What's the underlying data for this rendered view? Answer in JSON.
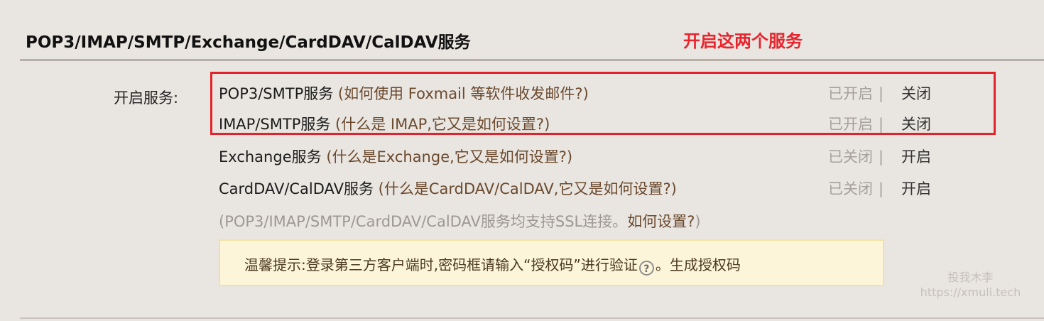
{
  "header": {
    "title": "POP3/IMAP/SMTP/Exchange/CardDAV/CalDAV服务"
  },
  "annotation": {
    "text": "开启这两个服务",
    "color": "#e8242d"
  },
  "enable_label": "开启服务:",
  "services": [
    {
      "name": "POP3/SMTP服务",
      "help": "(如何使用 Foxmail 等软件收发邮件?)",
      "status": "已开启",
      "separator": "|",
      "action": "关闭"
    },
    {
      "name": "IMAP/SMTP服务",
      "help": "(什么是 IMAP,它又是如何设置?)",
      "status": "已开启",
      "separator": "|",
      "action": "关闭"
    },
    {
      "name": "Exchange服务",
      "help": "(什么是Exchange,它又是如何设置?)",
      "status": "已关闭",
      "separator": "|",
      "action": "开启"
    },
    {
      "name": "CardDAV/CalDAV服务",
      "help": "(什么是CardDAV/CalDAV,它又是如何设置?)",
      "status": "已关闭",
      "separator": "|",
      "action": "开启"
    }
  ],
  "ssl_note": {
    "prefix": "(POP3/IMAP/SMTP/CardDAV/CalDAV服务均支持SSL连接。",
    "link": "如何设置?",
    "suffix": ")"
  },
  "tip": {
    "text": "温馨提示:登录第三方客户端时,密码框请输入“授权码”进行验证",
    "help_icon": "?",
    "after_icon": "。",
    "link": "生成授权码"
  },
  "watermark": {
    "line1": "投我木李",
    "line2": "https://xmuli.tech"
  }
}
